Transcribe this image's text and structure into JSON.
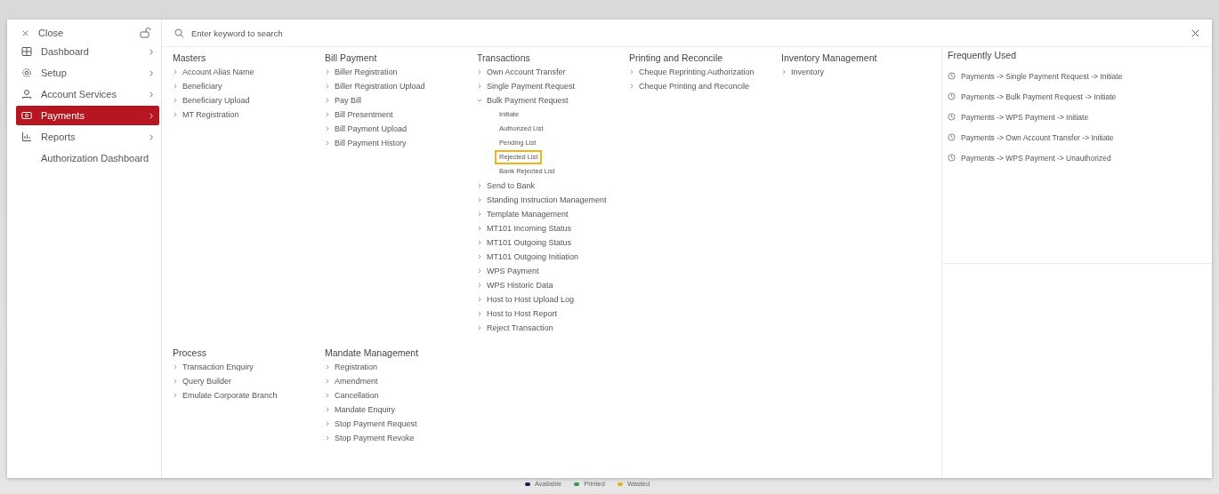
{
  "sidebar": {
    "close": "Close",
    "items": [
      {
        "label": "Dashboard",
        "kind": "group",
        "selected": false
      },
      {
        "label": "Setup",
        "kind": "group",
        "selected": false
      },
      {
        "label": "Account Services",
        "kind": "group",
        "selected": false
      },
      {
        "label": "Payments",
        "kind": "group",
        "selected": true
      },
      {
        "label": "Reports",
        "kind": "group",
        "selected": false
      },
      {
        "label": "Authorization Dashboard",
        "kind": "link",
        "selected": false
      }
    ]
  },
  "search": {
    "placeholder": "Enter keyword to search"
  },
  "menu_rows": [
    [
      {
        "title": "Masters",
        "items": [
          {
            "label": "Account Alias Name",
            "expanded": false
          },
          {
            "label": "Beneficiary",
            "expanded": false
          },
          {
            "label": "Beneficiary Upload",
            "expanded": false
          },
          {
            "label": "MT Registration",
            "expanded": false
          }
        ]
      },
      {
        "title": "Bill Payment",
        "items": [
          {
            "label": "Biller Registration",
            "expanded": false
          },
          {
            "label": "Biller Registration Upload",
            "expanded": false
          },
          {
            "label": "Pay Bill",
            "expanded": false
          },
          {
            "label": "Bill Presentment",
            "expanded": false
          },
          {
            "label": "Bill Payment Upload",
            "expanded": false
          },
          {
            "label": "Bill Payment History",
            "expanded": false
          }
        ]
      },
      {
        "title": "Transactions",
        "items": [
          {
            "label": "Own Account Transfer",
            "expanded": false
          },
          {
            "label": "Single Payment Request",
            "expanded": false
          },
          {
            "label": "Bulk Payment Request",
            "expanded": true,
            "children": [
              {
                "label": "Initiate",
                "selected": false
              },
              {
                "label": "Authorized List",
                "selected": false
              },
              {
                "label": "Pending List",
                "selected": false
              },
              {
                "label": "Rejected List",
                "selected": true
              },
              {
                "label": "Bank Rejected List",
                "selected": false
              }
            ]
          },
          {
            "label": "Send to Bank",
            "expanded": false
          },
          {
            "label": "Standing Instruction Management",
            "expanded": false
          },
          {
            "label": "Template Management",
            "expanded": false
          },
          {
            "label": "MT101 Incoming Status",
            "expanded": false
          },
          {
            "label": "MT101 Outgoing Status",
            "expanded": false
          },
          {
            "label": "MT101 Outgoing Initiation",
            "expanded": false
          },
          {
            "label": "WPS Payment",
            "expanded": false
          },
          {
            "label": "WPS Historic Data",
            "expanded": false
          },
          {
            "label": "Host to Host Upload Log",
            "expanded": false
          },
          {
            "label": "Host to Host Report",
            "expanded": false
          },
          {
            "label": "Reject Transaction",
            "expanded": false
          }
        ]
      },
      {
        "title": "Printing and Reconcile",
        "items": [
          {
            "label": "Cheque Reprinting Authorization",
            "expanded": false
          },
          {
            "label": "Cheque Printing and Reconcile",
            "expanded": false
          }
        ]
      },
      {
        "title": "Inventory Management",
        "items": [
          {
            "label": "Inventory",
            "expanded": false
          }
        ]
      }
    ],
    [
      {
        "title": "Process",
        "items": [
          {
            "label": "Transaction Enquiry",
            "expanded": false
          },
          {
            "label": "Query Builder",
            "expanded": false
          },
          {
            "label": "Emulate Corporate Branch",
            "expanded": false
          }
        ]
      },
      {
        "title": "Mandate Management",
        "items": [
          {
            "label": "Registration",
            "expanded": false
          },
          {
            "label": "Amendment",
            "expanded": false
          },
          {
            "label": "Cancellation",
            "expanded": false
          },
          {
            "label": "Mandate Enquiry",
            "expanded": false
          },
          {
            "label": "Stop Payment Request",
            "expanded": false
          },
          {
            "label": "Stop Payment Revoke",
            "expanded": false
          }
        ]
      }
    ]
  ],
  "frequently_used": {
    "title": "Frequently Used",
    "items": [
      "Payments -> Single Payment Request -> Initiate",
      "Payments -> Bulk Payment Request -> Initiate",
      "Payments -> WPS Payment -> Initiate",
      "Payments -> Own Account Transfer -> Initiate",
      "Payments -> WPS Payment -> Unauthorized"
    ]
  },
  "legend": [
    {
      "label": "Available",
      "color": "#1a1f4a"
    },
    {
      "label": "Printed",
      "color": "#2e9a4e"
    },
    {
      "label": "Wasted",
      "color": "#e0b020"
    }
  ]
}
